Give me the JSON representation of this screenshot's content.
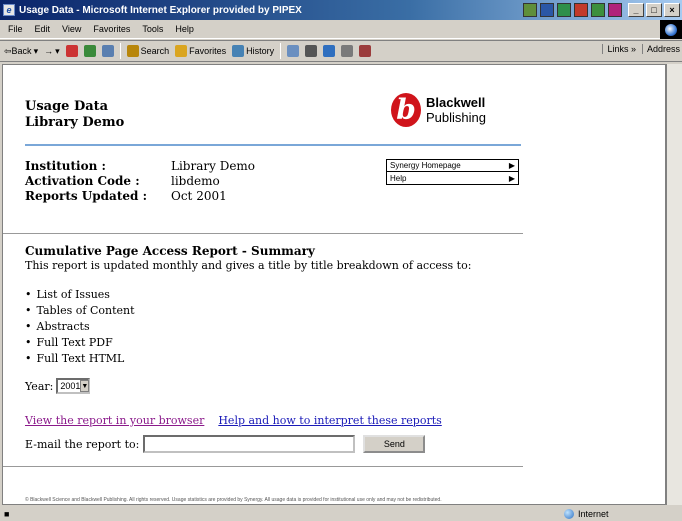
{
  "window": {
    "title": "Usage Data - Microsoft Internet Explorer provided by PIPEX"
  },
  "menu": [
    "File",
    "Edit",
    "View",
    "Favorites",
    "Tools",
    "Help"
  ],
  "toolbar": {
    "back": "⇦Back",
    "search": "Search",
    "favorites": "Favorites",
    "history": "History",
    "links": "Links »",
    "address": "Address"
  },
  "page": {
    "title_line1": "Usage Data",
    "title_line2": "Library Demo",
    "logo_mark": "b",
    "logo_line1": "Blackwell",
    "logo_line2": "Publishing",
    "info": [
      {
        "label": "Institution :",
        "value": "Library Demo"
      },
      {
        "label": "Activation Code :",
        "value": "libdemo"
      },
      {
        "label": "Reports Updated :",
        "value": "Oct 2001"
      }
    ],
    "side_links": [
      "Synergy Homepage",
      "Help"
    ],
    "report_title": "Cumulative Page Access Report - Summary",
    "report_desc": "This report is updated monthly and gives a title by title breakdown of access to:",
    "bullets": [
      "List of Issues",
      "Tables of Content",
      "Abstracts",
      "Full Text PDF",
      "Full Text HTML"
    ],
    "year_label": "Year:",
    "year_value": "2001",
    "link_view": "View the report in your browser",
    "link_help": "Help and how to interpret these reports",
    "email_label": "E-mail the report to:",
    "send_label": "Send",
    "footer": "© Blackwell Science and Blackwell Publishing. All rights reserved. Usage statistics are provided by Synergy. All usage data is provided for institutional use only and may not be redistributed."
  },
  "status": {
    "zone": "Internet"
  },
  "colors": {
    "brand_red": "#d0141b",
    "accent_blue": "#7aa7d8",
    "visited_link": "#8b1a8b",
    "link": "#1a1ab8"
  }
}
